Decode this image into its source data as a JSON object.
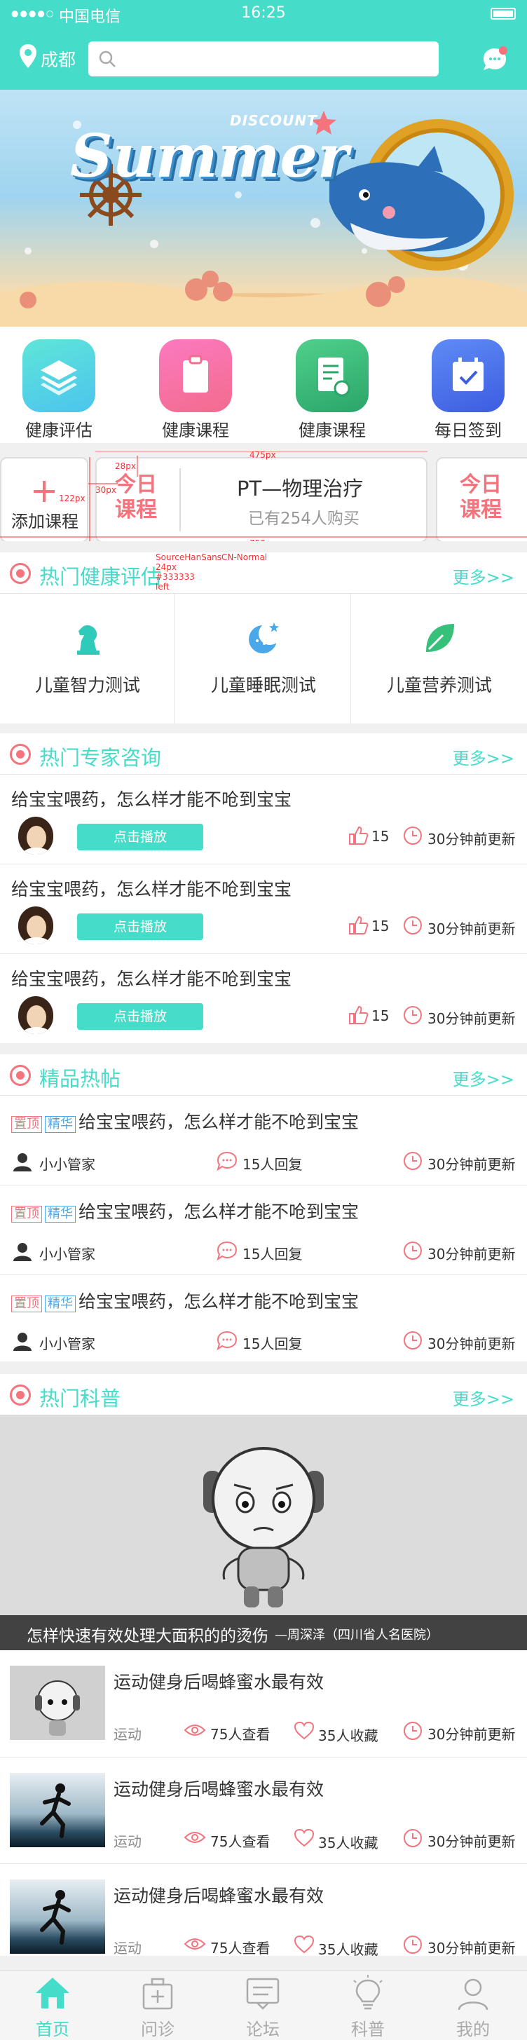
{
  "status": {
    "dots": "●●●●○",
    "carrier": "中国电信",
    "time": "16:25"
  },
  "topbar": {
    "city": "成都",
    "search_placeholder": ""
  },
  "banner": {
    "subtitle": "DISCOUNT",
    "title": "Summer"
  },
  "quick": [
    {
      "label": "健康评估",
      "color": "#4ed8e0",
      "icon": "layers-icon"
    },
    {
      "label": "健康课程",
      "color": "#f46fa6",
      "icon": "clipboard-icon"
    },
    {
      "label": "健康课程",
      "color": "#36c07a",
      "icon": "document-icon"
    },
    {
      "label": "每日签到",
      "color": "#4e6ff2",
      "icon": "calendar-check-icon"
    }
  ],
  "course": {
    "add_label": "添加课程",
    "today_1": "今日",
    "today_2": "课程",
    "name": "PT—物理治疗",
    "buyers": "已有254人购买",
    "annotations": {
      "w1": "475px",
      "h1": "28px",
      "l1": "30px",
      "h2": "122px",
      "w2": "750px",
      "font": "SourceHanSansCN-Normal",
      "size": "24px",
      "color": "#333333",
      "align": "left"
    }
  },
  "eval": {
    "title": "热门健康评估",
    "more": "更多>>",
    "items": [
      {
        "label": "儿童智力测试",
        "icon": "chess-knight-icon"
      },
      {
        "label": "儿童睡眠测试",
        "icon": "moon-star-icon"
      },
      {
        "label": "儿童营养测试",
        "icon": "leaf-icon"
      }
    ]
  },
  "consult": {
    "title": "热门专家咨询",
    "more": "更多>>",
    "items": [
      {
        "question": "给宝宝喂药，怎么样才能不呛到宝宝",
        "play": "点击播放",
        "likes": "15",
        "time": "30分钟前更新"
      },
      {
        "question": "给宝宝喂药，怎么样才能不呛到宝宝",
        "play": "点击播放",
        "likes": "15",
        "time": "30分钟前更新"
      },
      {
        "question": "给宝宝喂药，怎么样才能不呛到宝宝",
        "play": "点击播放",
        "likes": "15",
        "time": "30分钟前更新"
      }
    ]
  },
  "posts": {
    "title": "精品热帖",
    "more": "更多>>",
    "items": [
      {
        "tag1": "置顶",
        "tag2": "精华",
        "title": "给宝宝喂药，怎么样才能不呛到宝宝",
        "author": "小小管家",
        "replies": "15人回复",
        "time": "30分钟前更新"
      },
      {
        "tag1": "置顶",
        "tag2": "精华",
        "title": "给宝宝喂药，怎么样才能不呛到宝宝",
        "author": "小小管家",
        "replies": "15人回复",
        "time": "30分钟前更新"
      },
      {
        "tag1": "置顶",
        "tag2": "精华",
        "title": "给宝宝喂药，怎么样才能不呛到宝宝",
        "author": "小小管家",
        "replies": "15人回复",
        "time": "30分钟前更新"
      }
    ]
  },
  "science": {
    "title": "热门科普",
    "more": "更多>>",
    "caption": "怎样快速有效处理大面积的的烫伤",
    "caption_author": "—周深泽（四川省人名医院）",
    "items": [
      {
        "title": "运动健身后喝蜂蜜水最有效",
        "category": "运动",
        "views": "75人查看",
        "favs": "35人收藏",
        "time": "30分钟前更新",
        "thumb": "cartoon"
      },
      {
        "title": "运动健身后喝蜂蜜水最有效",
        "category": "运动",
        "views": "75人查看",
        "favs": "35人收藏",
        "time": "30分钟前更新",
        "thumb": "runner"
      },
      {
        "title": "运动健身后喝蜂蜜水最有效",
        "category": "运动",
        "views": "75人查看",
        "favs": "35人收藏",
        "time": "30分钟前更新",
        "thumb": "runner"
      }
    ]
  },
  "tabs": [
    {
      "label": "首页",
      "icon": "home-icon",
      "active": true
    },
    {
      "label": "问诊",
      "icon": "medical-kit-icon",
      "active": false
    },
    {
      "label": "论坛",
      "icon": "forum-icon",
      "active": false
    },
    {
      "label": "科普",
      "icon": "bulb-icon",
      "active": false
    },
    {
      "label": "我的",
      "icon": "user-icon",
      "active": false
    }
  ],
  "colors": {
    "accent": "#45dcc9",
    "pink": "#f4747e",
    "blue_tag": "#4aa7e8"
  }
}
